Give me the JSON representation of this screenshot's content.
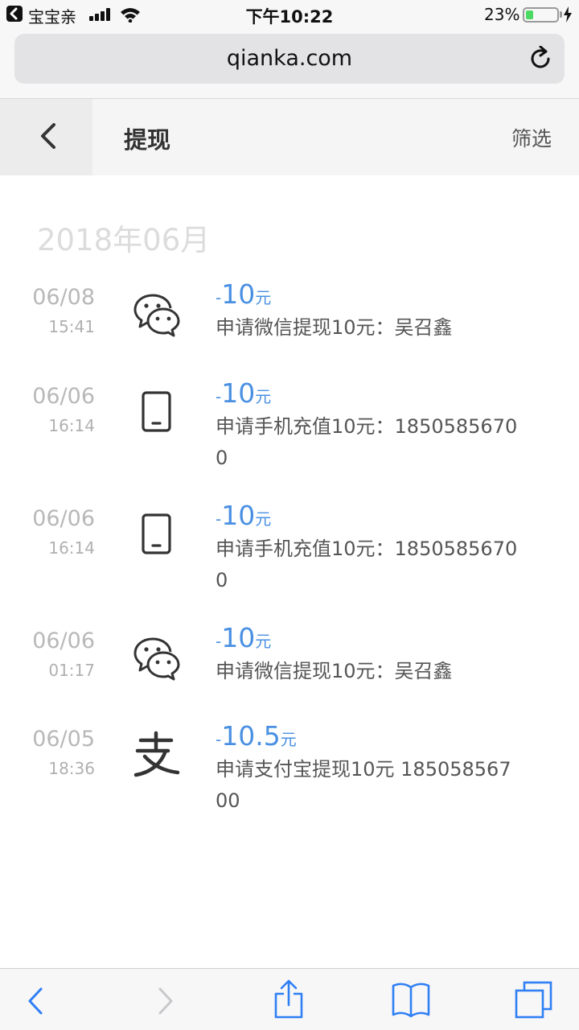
{
  "status_bar": {
    "back_app": "宝宝亲",
    "time": "下午10:22",
    "battery_percent": "23%",
    "battery_level": 0.23
  },
  "browser": {
    "url": "qianka.com"
  },
  "header": {
    "title": "提现",
    "filter_label": "筛选"
  },
  "month": "2018年06月",
  "records": [
    {
      "date": "06/08",
      "time": "15:41",
      "icon": "wechat-icon",
      "minus": "-",
      "amount": "10",
      "unit": "元",
      "description": "申请微信提现10元：吴召鑫"
    },
    {
      "date": "06/06",
      "time": "16:14",
      "icon": "phone-icon",
      "minus": "-",
      "amount": "10",
      "unit": "元",
      "description": "申请手机充值10元：18505856700"
    },
    {
      "date": "06/06",
      "time": "16:14",
      "icon": "phone-icon",
      "minus": "-",
      "amount": "10",
      "unit": "元",
      "description": "申请手机充值10元：18505856700"
    },
    {
      "date": "06/06",
      "time": "01:17",
      "icon": "wechat-icon",
      "minus": "-",
      "amount": "10",
      "unit": "元",
      "description": "申请微信提现10元：吴召鑫"
    },
    {
      "date": "06/05",
      "time": "18:36",
      "icon": "alipay-icon",
      "minus": "-",
      "amount": "10.5",
      "unit": "元",
      "description": "申请支付宝提现10元 18505856700"
    }
  ],
  "colors": {
    "accent": "#4a90e2",
    "muted_text": "#b8b8b8",
    "icon": "#333333"
  }
}
